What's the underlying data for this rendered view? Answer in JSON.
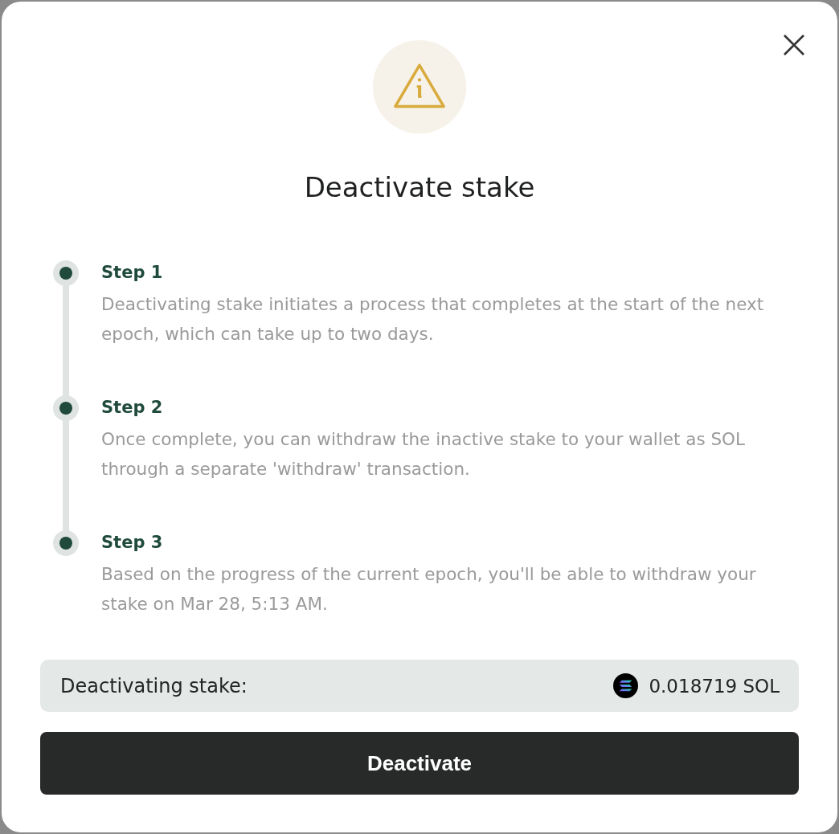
{
  "dialog": {
    "title": "Deactivate stake",
    "steps": [
      {
        "title": "Step 1",
        "description": "Deactivating stake initiates a process that completes at the start of the next epoch, which can take up to two days."
      },
      {
        "title": "Step 2",
        "description": "Once complete, you can withdraw the inactive stake to your wallet as SOL through a separate 'withdraw' transaction."
      },
      {
        "title": "Step 3",
        "description": "Based on the progress of the current epoch, you'll be able to withdraw your stake on Mar 28, 5:13 AM."
      }
    ],
    "summary": {
      "label": "Deactivating stake:",
      "amount": "0.018719 SOL"
    },
    "primary_button": {
      "label": "Deactivate"
    }
  }
}
